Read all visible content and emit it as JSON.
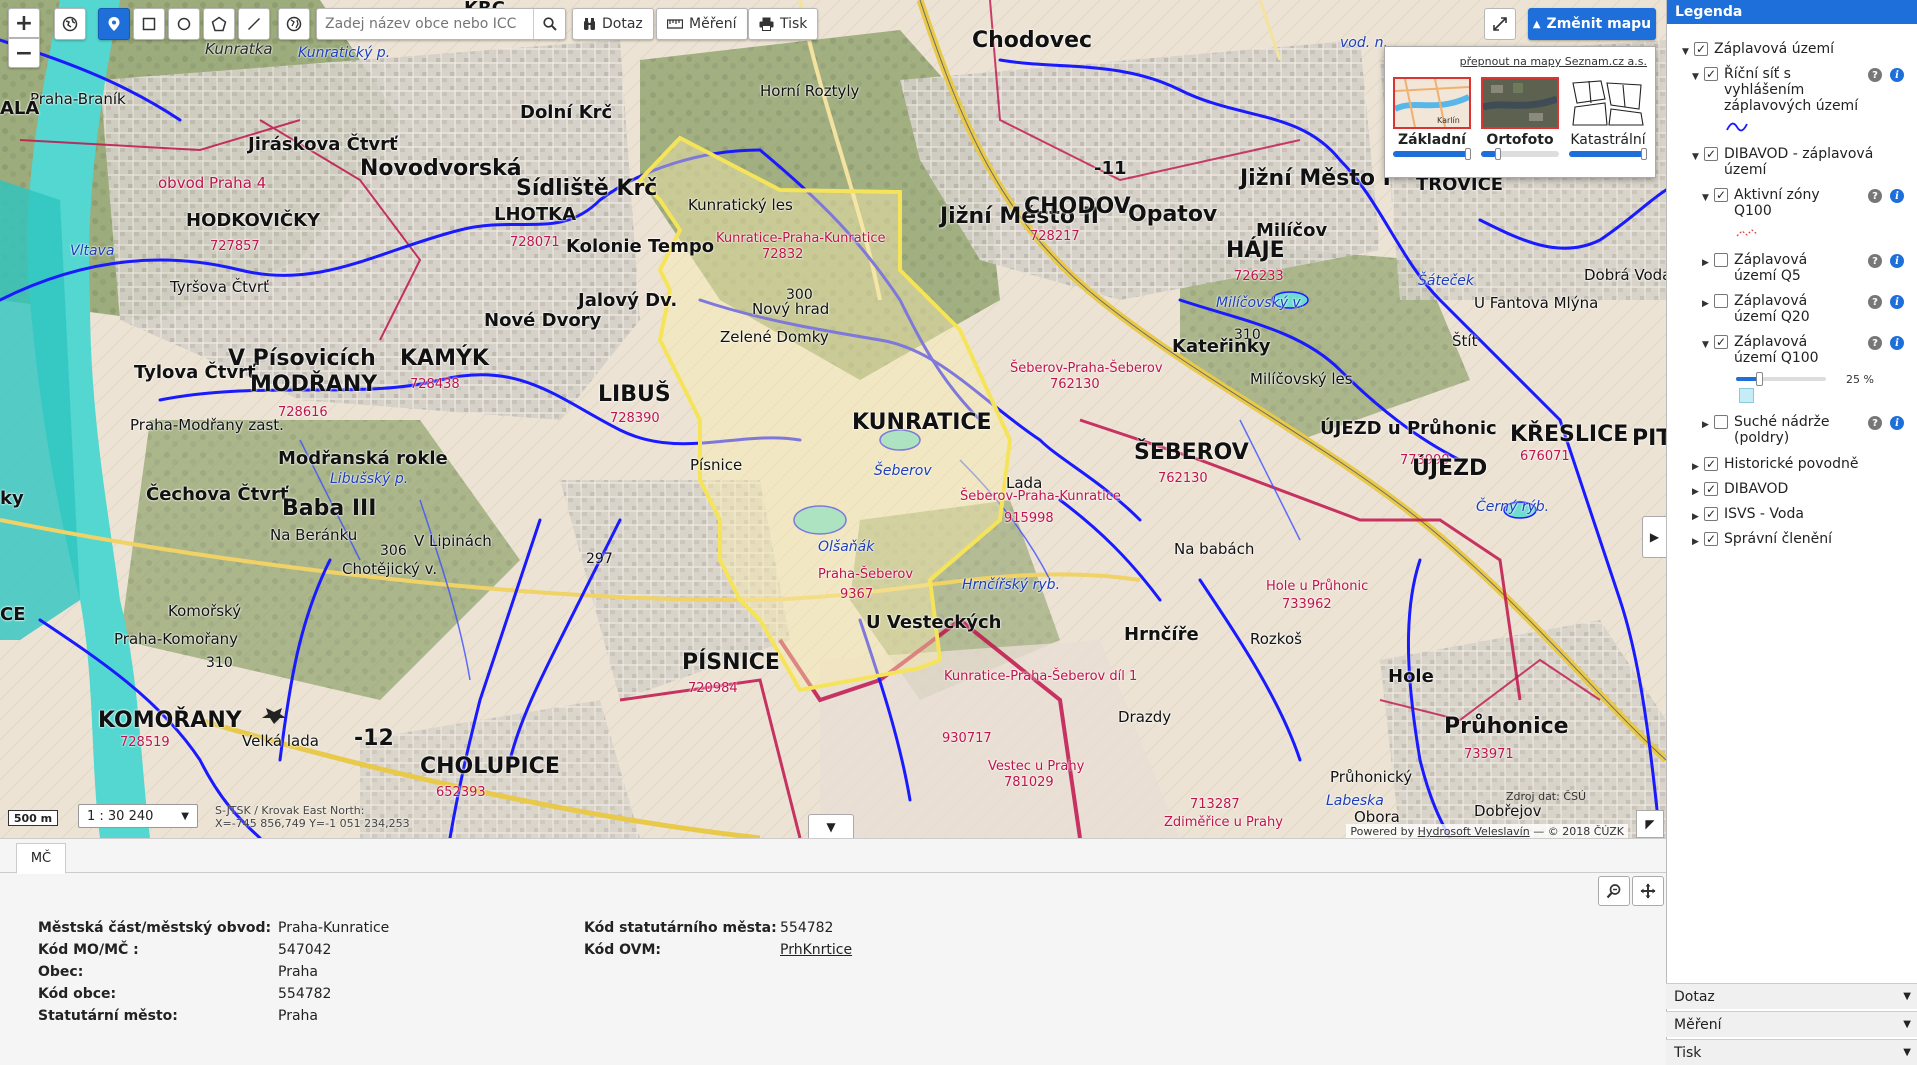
{
  "toolbar": {
    "search_placeholder": "Zadej název obce nebo ICC",
    "dotaz_label": "Dotaz",
    "mereni_label": "Měření",
    "tisk_label": "Tisk",
    "zmenit_mapu_label": "Změnit mapu",
    "active_tool": "point-select-icon"
  },
  "basemap": {
    "seznam_link": "přepnout na mapy Seznam.cz a.s.",
    "options": [
      {
        "name": "Základní",
        "opacity_pct": 100,
        "selected": true
      },
      {
        "name": "Ortofoto",
        "opacity_pct": 20,
        "selected": true
      },
      {
        "name": "Katastrální",
        "opacity_pct": 100,
        "selected": false
      }
    ],
    "thumb_label": "Karlín"
  },
  "map_labels": {
    "chodovec": "Chodovec",
    "kundratka": "Kunratka",
    "horni_roztyly": "Horní Roztyly",
    "dolni_krc": "Dolní Krč",
    "jiraskova_ctvrt": "Jiráskova Čtvrť",
    "novodvorska": "Novodvorská",
    "sidliste_krc": "Sídliště Krč",
    "lhotka": "LHOTKA",
    "obvod_praha4": "obvod Praha 4",
    "hodkovicky": "HODKOVIČKY",
    "hodkovicky_code": "727857",
    "lhotka_code": "728071",
    "kolonie_tempo": "Kolonie Tempo",
    "jalovy_dv": "Jalový Dv.",
    "kunraticky_les": "Kunratický les",
    "kunratice_praha_kunratice": "Kunratice-Praha-Kunratice",
    "kunratice_code_top": "72832",
    "jizni_mesto_ii": "Jižní Město II",
    "chodov": "CHODOV",
    "chodov_code": "728217",
    "opatov": "Opatov",
    "jizni_mesto_i": "Jižní Město I",
    "milicov": "Milíčov",
    "haje": "HÁJE",
    "haje_code": "726233",
    "trovice": "TROVICE",
    "elev_11": "-11",
    "tyrsova_ctvrt": "Tyršova Čtvrť",
    "nove_dvory": "Nové Dvory",
    "novy_hrad": "Nový hrad",
    "elev_300": "300",
    "zelene_domky": "Zelené Domky",
    "v_pisovicich": "V Písovicích",
    "kamyk": "KAMÝK",
    "kamyk_code": "728438",
    "tylova_ctvrt": "Tylova Čtvrť",
    "modrany": "MODŘANY",
    "modrany_code": "728616",
    "libus": "LIBUŠ",
    "libus_code": "728390",
    "kunratice": "KUNRATICE",
    "milicovsky_v": "Milíčovský v.",
    "elev_310": "310",
    "katerinky": "Kateřinky",
    "milicovsky_les": "Milíčovský les",
    "seberov_praha_seberov": "Šeberov-Praha-Šeberov",
    "seberov_code_top": "762130",
    "satecek": "Šáteček",
    "u_fantova_mlyna": "U Fantova Mlýna",
    "stit": "Štít",
    "dobra_voda": "Dobrá Voda",
    "praha_modrany_zast": "Praha-Modřany zast.",
    "modranska_rokle": "Modřanská rokle",
    "cechova_ctvrt": "Čechova Čtvrť",
    "libussky_p": "Libušský p.",
    "pisnice_upper": "Písnice",
    "seberov_upper": "Šeberov",
    "seberov": "ŠEBEROV",
    "seberov_code": "762130",
    "ujezd_u_pruhonic": "ÚJEZD u Průhonic",
    "ujezd_code": "773999",
    "kreslice": "KŘESLICE",
    "kreslice_code": "676071",
    "pitk": "PITK",
    "lada": "Lada",
    "seberov_praha_kunratice": "Šeberov-Praha-Kunratice",
    "seberov_kunr_code": "915998",
    "cerny_ryb": "Černý rýb.",
    "ujezd": "ÚJEZD",
    "baba_iii": "Baba III",
    "na_beranku": "Na Beránku",
    "elev_306": "306",
    "v_lipinach": "V Lipinách",
    "chotejicky_v": "Chotějický v.",
    "elev_297": "297",
    "olsanak": "Olšaňák",
    "praha_seberov": "Praha-Šeberov",
    "code_9367": "9367",
    "hrncirsky_ryb": "Hrnčířský ryb.",
    "na_babach": "Na babách",
    "hole_u_pruhonic": "Hole u Průhonic",
    "hole_code": "733962",
    "komorsky": "Komořský",
    "praha_komorany": "Praha-Komořany",
    "u_vestecky": "U Vesteckých",
    "hrncire": "Hrnčíře",
    "rozkos": "Rozkoš",
    "hole": "Hole",
    "elev_310b": "310",
    "pisnice": "PÍSNICE",
    "pisnice_code": "720984",
    "kunratice_praha_seberov_dil": "Kunratice-Praha-Šeberov díl 1",
    "kunr_seb_code": "930717",
    "drazdy": "Drazdy",
    "pruhonice": "Průhonice",
    "pruhonice_code": "733971",
    "komorany": "KOMOŘANY",
    "komorany_code": "728519",
    "velka_lada": "Velká lada",
    "elev_12": "-12",
    "cholupice": "CHOLUPICE",
    "cholupice_code": "652393",
    "vestec_u_prahy": "Vestec u Prahy",
    "vestec_code": "781029",
    "code_713287": "713287",
    "zdimerice_u_prahy": "Zdiměřice u Prahy",
    "pruhonicky": "Průhonický",
    "labeska": "Labeska",
    "obora": "Obora",
    "dobreju": "Dobřejov",
    "vltava": "Vltava",
    "ala": "ALÁ",
    "ky": "ky",
    "ce": "CE",
    "krc": "KRC",
    "kunraticky_p": "Kunratický p.",
    "praha_branik": "Praha-Braník",
    "vod_n": "vod. n."
  },
  "map_footer": {
    "scale_bar": "500 m",
    "scale_value": "1 : 30 240",
    "coords_line1": "S-JTSK / Krovak East North:",
    "coords_line2": "X=-745 856,749 Y=-1 051 234,253",
    "credit_prefix": "Powered by ",
    "credit_link": "Hydrosoft Veleslavín",
    "credit_suffix": " — © 2018 ČÚZK",
    "source_note": "Zdroj dat: ČSÚ"
  },
  "info_panel": {
    "tab": "MČ",
    "left_attrs": [
      {
        "key": "Městská část/městský obvod:",
        "value": "Praha-Kunratice"
      },
      {
        "key": "Kód MO/MČ :",
        "value": "547042"
      },
      {
        "key": "Obec:",
        "value": "Praha"
      },
      {
        "key": "Kód obce:",
        "value": "554782"
      },
      {
        "key": "Statutární město:",
        "value": "Praha"
      }
    ],
    "right_attrs": [
      {
        "key": "Kód statutárního města:",
        "value": "554782"
      },
      {
        "key": "Kód OVM:",
        "value": "PrhKnrtice"
      }
    ]
  },
  "legend": {
    "title": "Legenda",
    "items": [
      {
        "label": "Záplavová území",
        "checked": true,
        "expanded": true
      },
      {
        "label": "Říční síť s vyhlášením záplavových území",
        "checked": true,
        "expanded": true
      },
      {
        "label": "DIBAVOD - záplavová území",
        "checked": true,
        "expanded": true
      },
      {
        "label": "Aktivní zóny Q100",
        "checked": true,
        "expanded": true
      },
      {
        "label": "Záplavová území Q5",
        "checked": false,
        "expanded": false
      },
      {
        "label": "Záplavová území Q20",
        "checked": false,
        "expanded": false
      },
      {
        "label": "Záplavová území Q100",
        "checked": true,
        "expanded": true
      },
      {
        "label": "Suché nádrže (poldry)",
        "checked": false,
        "expanded": false
      },
      {
        "label": "Historické povodně",
        "checked": true,
        "expanded": false
      },
      {
        "label": "DIBAVOD",
        "checked": true,
        "expanded": false
      },
      {
        "label": "ISVS - Voda",
        "checked": true,
        "expanded": false
      },
      {
        "label": "Správní členění",
        "checked": true,
        "expanded": false
      }
    ],
    "q100_opacity": "25 %",
    "q100_opacity_fraction": 0.25,
    "accordion": [
      "Dotaz",
      "Měření",
      "Tisk"
    ],
    "colors": {
      "accent": "#1e6fd9",
      "river": "#1a1aff",
      "boundary": "#c0144c",
      "selection": "#f5e45a"
    }
  }
}
